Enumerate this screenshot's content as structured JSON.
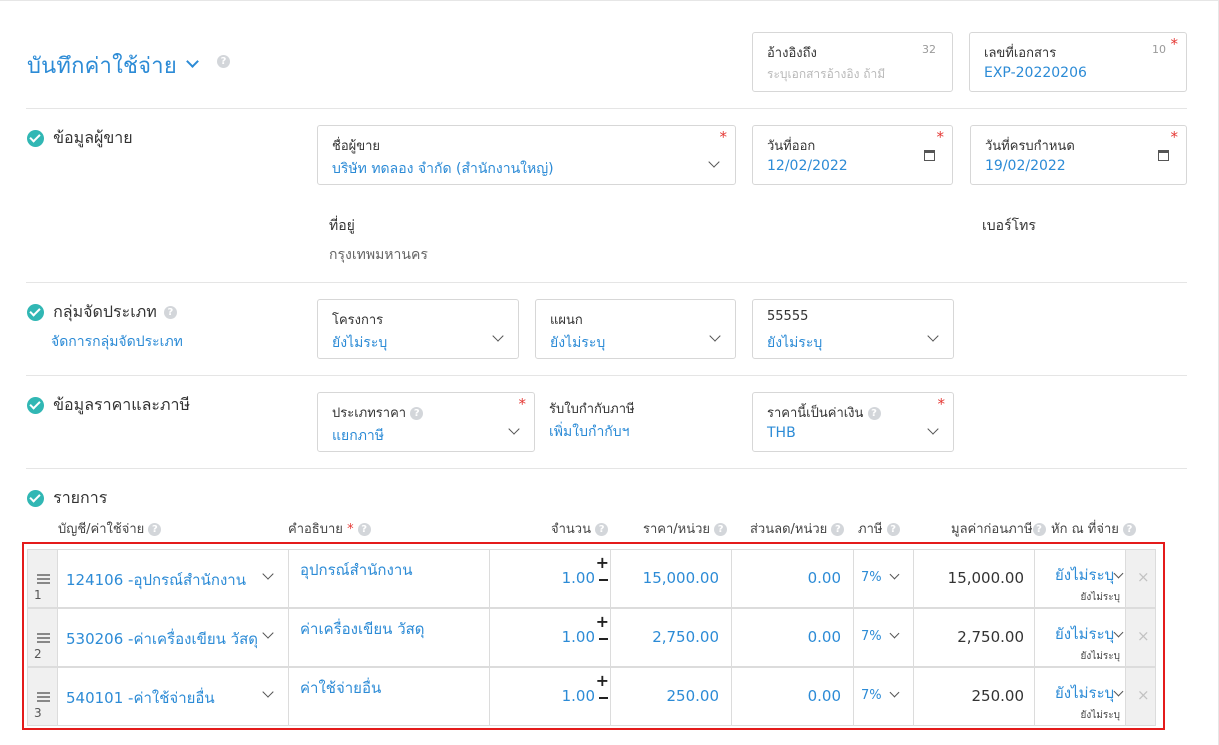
{
  "header": {
    "title": "บันทึกค่าใช้จ่าย",
    "reference": {
      "label": "อ้างอิงถึง",
      "count": "32",
      "placeholder": "ระบุเอกสารอ้างอิง ถ้ามี"
    },
    "doc_number": {
      "label": "เลขที่เอกสาร",
      "count": "10",
      "value": "EXP-20220206"
    }
  },
  "required_mark": "*",
  "help_mark": "?",
  "sections": {
    "vendor": {
      "title": "ข้อมูลผู้ขาย",
      "vendor_name": {
        "label": "ชื่อผู้ขาย",
        "value": "บริษัท ทดลอง จำกัด (สำนักงานใหญ่)"
      },
      "issue_date": {
        "label": "วันที่ออก",
        "value": "12/02/2022"
      },
      "due_date": {
        "label": "วันที่ครบกำหนด",
        "value": "19/02/2022"
      },
      "address": {
        "label": "ที่อยู่",
        "value": "กรุงเทพมหานคร"
      },
      "phone": {
        "label": "เบอร์โทร"
      }
    },
    "classification": {
      "title": "กลุ่มจัดประเภท",
      "manage_link": "จัดการกลุ่มจัดประเภท",
      "project": {
        "label": "โครงการ",
        "value": "ยังไม่ระบุ"
      },
      "department": {
        "label": "แผนก",
        "value": "ยังไม่ระบุ"
      },
      "custom": {
        "label": "55555",
        "value": "ยังไม่ระบุ"
      }
    },
    "pricing": {
      "title": "ข้อมูลราคาและภาษี",
      "price_type": {
        "label": "ประเภทราคา",
        "value": "แยกภาษี"
      },
      "tax_invoice": {
        "label": "รับใบกำกับภาษี",
        "link": "เพิ่มใบกำกับฯ"
      },
      "currency": {
        "label": "ราคานี้เป็นค่าเงิน",
        "value": "THB"
      }
    },
    "items": {
      "title": "รายการ",
      "headers": {
        "account": "บัญชี/ค่าใช้จ่าย",
        "description": "คำอธิบาย",
        "quantity": "จำนวน",
        "unit_price": "ราคา/หน่วย",
        "discount": "ส่วนลด/หน่วย",
        "vat": "ภาษี",
        "pre_tax": "มูลค่าก่อนภาษี",
        "withholding": "หัก ณ ที่จ่าย"
      },
      "rows": [
        {
          "no": "1",
          "account": "124106 -อุปกรณ์สำนักงาน",
          "description": "อุปกรณ์สำนักงาน",
          "quantity": "1.00",
          "unit_price": "15,000.00",
          "discount": "0.00",
          "vat": "7%",
          "pre_tax": "15,000.00",
          "withholding": "ยังไม่ระบุ",
          "withholding_sub": "ยังไม่ระบุ"
        },
        {
          "no": "2",
          "account": "530206 -ค่าเครื่องเขียน วัสดุ",
          "description": "ค่าเครื่องเขียน วัสดุ",
          "quantity": "1.00",
          "unit_price": "2,750.00",
          "discount": "0.00",
          "vat": "7%",
          "pre_tax": "2,750.00",
          "withholding": "ยังไม่ระบุ",
          "withholding_sub": "ยังไม่ระบุ"
        },
        {
          "no": "3",
          "account": "540101 -ค่าใช้จ่ายอื่น",
          "description": "ค่าใช้จ่ายอื่น",
          "quantity": "1.00",
          "unit_price": "250.00",
          "discount": "0.00",
          "vat": "7%",
          "pre_tax": "250.00",
          "withholding": "ยังไม่ระบุ",
          "withholding_sub": "ยังไม่ระบุ"
        }
      ]
    }
  },
  "colors": {
    "accent": "#2c8bd6",
    "check": "#31b7b4",
    "required": "#e53935",
    "highlight_border": "#e41b1b"
  }
}
